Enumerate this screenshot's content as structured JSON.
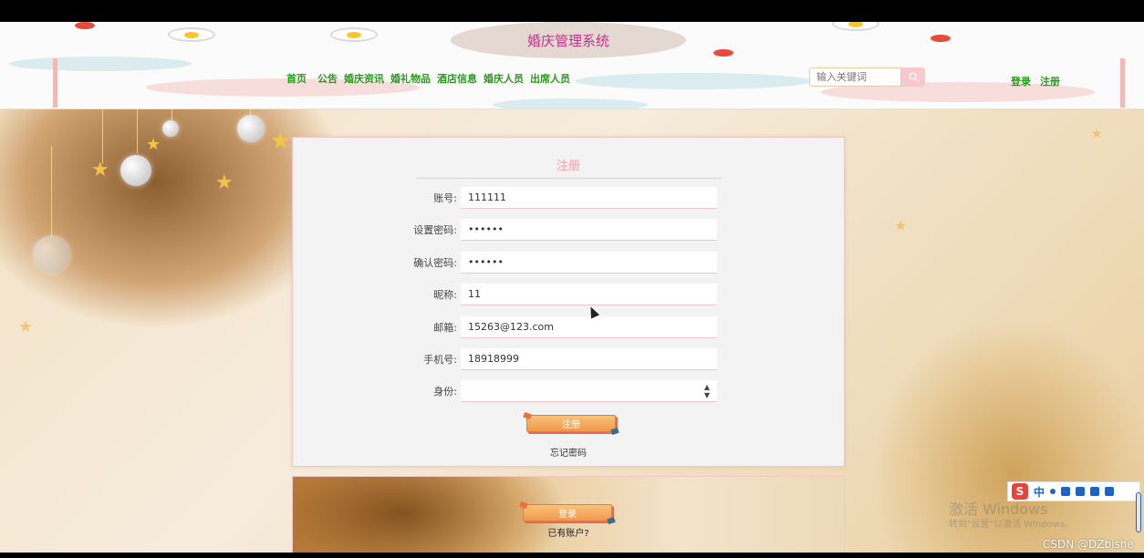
{
  "app": {
    "title": "婚庆管理系统"
  },
  "nav": {
    "items": [
      "首页",
      "公告",
      "婚庆资讯",
      "婚礼物品",
      "酒店信息",
      "婚庆人员",
      "出席人员"
    ]
  },
  "search": {
    "placeholder": "输入关键词",
    "value": ""
  },
  "auth": {
    "login": "登录",
    "register": "注册"
  },
  "form": {
    "title": "注册",
    "fields": [
      {
        "label": "账号:",
        "value": "111111"
      },
      {
        "label": "设置密码:",
        "value": "••••••"
      },
      {
        "label": "确认密码:",
        "value": "••••••"
      },
      {
        "label": "昵称:",
        "value": "11"
      },
      {
        "label": "邮箱:",
        "value": "15263@123.com"
      },
      {
        "label": "手机号:",
        "value": "18918999"
      },
      {
        "label": "身份:",
        "value": ""
      }
    ],
    "submit_label": "注册",
    "forgot_label": "忘记密码"
  },
  "login_card": {
    "login_label": "登录",
    "have_account": "已有账户?"
  },
  "ime": {
    "lang": "中"
  },
  "watermark": {
    "line1": "激活 Windows",
    "line2": "转到\"设置\"以激活 Windows。"
  },
  "credit": {
    "text": "CSDN @DZbishe"
  },
  "colors": {
    "nav_green": "#2a9a1c",
    "title_pink": "#c8308a",
    "form_title_pink": "#f7b6bf"
  },
  "icons": {
    "search": "search-icon",
    "select_caret": "chevron-updown-icon"
  }
}
